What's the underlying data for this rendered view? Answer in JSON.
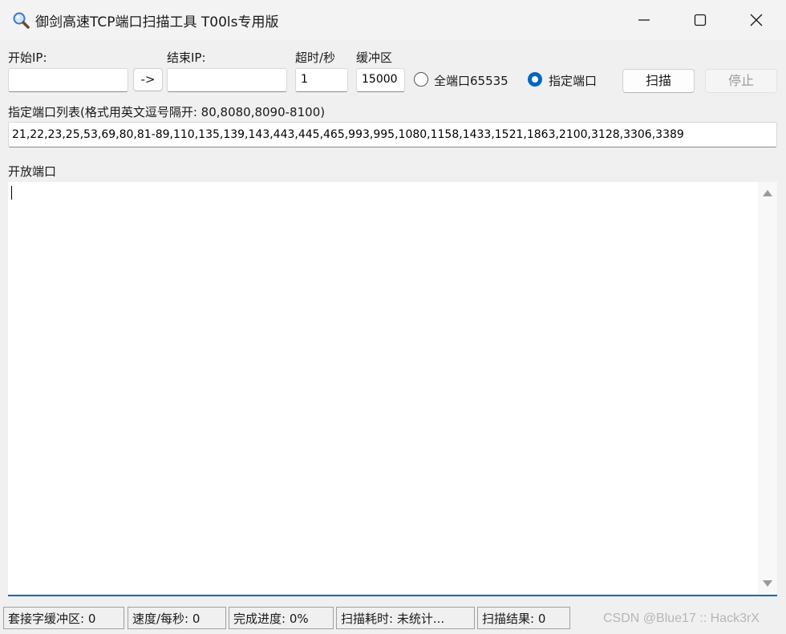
{
  "window": {
    "title": "御剑高速TCP端口扫描工具 T00ls专用版",
    "icon": "magnifier-icon"
  },
  "form": {
    "start_ip_label": "开始IP:",
    "start_ip_value": "",
    "arrow_button_label": "->",
    "end_ip_label": "结束IP:",
    "end_ip_value": "",
    "timeout_label": "超时/秒",
    "timeout_value": "1",
    "buffer_label": "缓冲区",
    "buffer_value": "15000",
    "all_ports_label": "全端口65535",
    "specified_ports_label": "指定端口",
    "selected_mode": "specified",
    "scan_button_label": "扫描",
    "stop_button_label": "停止",
    "port_list_label": "指定端口列表(格式用英文逗号隔开: 80,8080,8090-8100)",
    "port_list_value": "21,22,23,25,53,69,80,81-89,110,135,139,143,443,445,465,993,995,1080,1158,1433,1521,1863,2100,3128,3306,3389"
  },
  "output": {
    "label": "开放端口",
    "content": ""
  },
  "status": {
    "socket_buffer": "套接字缓冲区: 0",
    "speed": "速度/每秒: 0",
    "progress": "完成进度: 0%",
    "elapsed": "扫描耗时: 未统计...",
    "result": "扫描结果: 0"
  },
  "watermark": "CSDN @Blue17 :: Hack3rX",
  "colors": {
    "accent": "#0067c0",
    "background": "#f0f0f0"
  }
}
